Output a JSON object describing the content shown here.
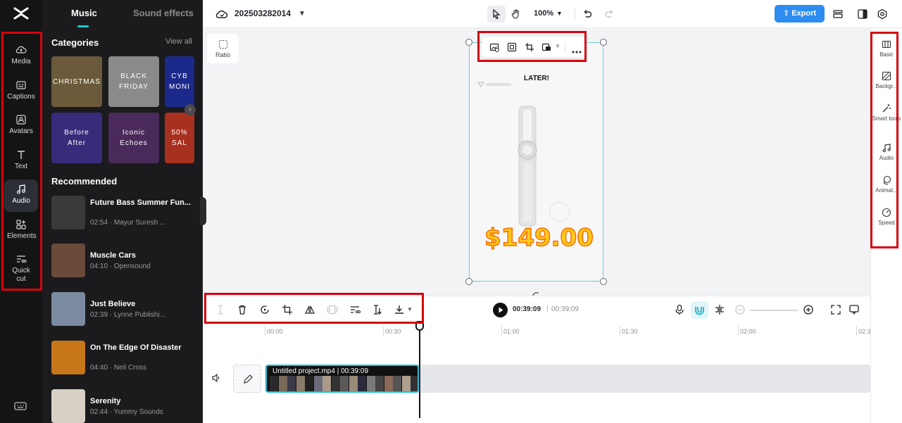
{
  "app": {
    "logo_icon": "capcut-logo-icon"
  },
  "left_rail": {
    "items": [
      {
        "label": "Media",
        "icon": "cloud-upload-icon"
      },
      {
        "label": "Captions",
        "icon": "captions-icon"
      },
      {
        "label": "Avatars",
        "icon": "avatar-icon"
      },
      {
        "label": "Text",
        "icon": "text-icon"
      },
      {
        "label": "Audio",
        "icon": "music-note-icon",
        "active": true
      },
      {
        "label": "Elements",
        "icon": "elements-icon"
      },
      {
        "label": "Quick cut",
        "icon": "quick-cut-icon"
      }
    ]
  },
  "panel": {
    "tabs": {
      "music": "Music",
      "sound_effects": "Sound effects"
    },
    "categories_title": "Categories",
    "view_all": "View all",
    "categories": [
      {
        "label": "CHRISTMAS",
        "color": "#6b5a3a"
      },
      {
        "label": "BLACK\nFRIDAY",
        "color": "#8a8a8a"
      },
      {
        "label": "CYB\nMONI",
        "color": "#1b2a8a"
      },
      {
        "label": "Before\nAfter",
        "color": "#3a2a7a"
      },
      {
        "label": "Iconic\nEchoes",
        "color": "#4a2a5a"
      },
      {
        "label": "50%\nSAL",
        "color": "#a8301f"
      }
    ],
    "recommended_title": "Recommended",
    "songs": [
      {
        "title": "Future Bass Summer Fun...",
        "meta": "02:54 · Mayur Suresh ...",
        "color": "#3a3a3a"
      },
      {
        "title": "Muscle Cars",
        "meta": "04:10 · Opensound",
        "color": "#6a4a3a"
      },
      {
        "title": "Just Believe",
        "meta": "02:39 · Lynne Publishi...",
        "color": "#7a8aa0"
      },
      {
        "title": "On The Edge Of Disaster",
        "meta": "04:40 · Neil Cross",
        "color": "#c8761a"
      },
      {
        "title": "Serenity",
        "meta": "02:44 · Yummy Sounds",
        "color": "#d8d0c4"
      }
    ]
  },
  "topbar": {
    "project_name": "202503282014",
    "zoom": "100%",
    "export_label": "Export"
  },
  "canvas": {
    "ratio_label": "Ratio",
    "later_text": "LATER!",
    "price_text": "$149.00"
  },
  "right_sidebar": {
    "items": [
      {
        "label": "Basic",
        "icon": "basic-icon"
      },
      {
        "label": "Backgr...",
        "icon": "background-icon"
      },
      {
        "label": "Smart tools",
        "icon": "magic-wand-icon"
      },
      {
        "label": "Audio",
        "icon": "music-note-icon"
      },
      {
        "label": "Animat...",
        "icon": "animation-icon"
      },
      {
        "label": "Speed",
        "icon": "speed-icon"
      }
    ]
  },
  "timeline_toolbar": {
    "current_time": "00:39:09",
    "separator": "|",
    "total_time": "00:39:09"
  },
  "timeline": {
    "ticks": [
      "00:00",
      "00:30",
      "01:00",
      "01:30",
      "02:00",
      "02:3"
    ],
    "clip_label": "Untitled project.mp4 | 00:39:09"
  },
  "colors": {
    "accent": "#2d8cf0",
    "selection": "#20c0d8",
    "annotation": "#d4040d"
  }
}
